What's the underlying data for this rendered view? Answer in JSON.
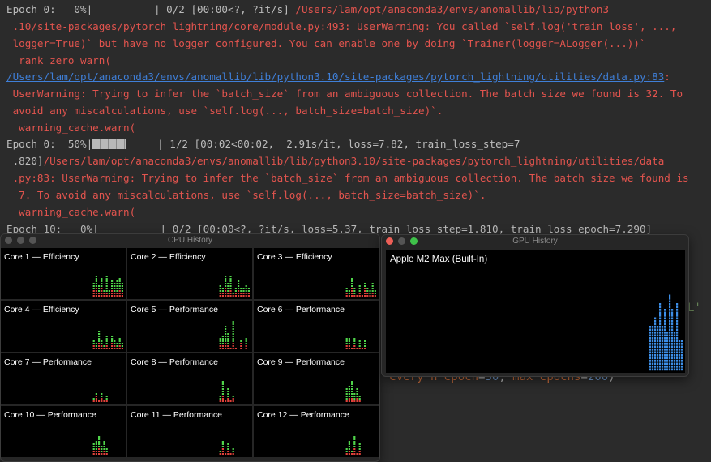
{
  "terminal": {
    "lines": [
      {
        "pre": "Epoch 0:   0%|          | 0/2 [00:00<?, ?it/s] ",
        "text": "/Users/lam/opt/anaconda3/envs/anomallib/lib/python3"
      },
      {
        "text": " .10/site-packages/pytorch_lightning/core/module.py:493: UserWarning: You called `self.log('train_loss', ...,"
      },
      {
        "text": " logger=True)` but have no logger configured. You can enable one by doing `Trainer(logger=ALogger(...))`"
      },
      {
        "text": "  rank_zero_warn("
      },
      {
        "link": "/Users/lam/opt/anaconda3/envs/anomallib/lib/python3.10/site-packages/pytorch_lightning/utilities/data.py:83",
        "text": ":"
      },
      {
        "text": " UserWarning: Trying to infer the `batch_size` from an ambiguous collection. The batch size we found is 32. To"
      },
      {
        "text": " avoid any miscalculations, use `self.log(..., batch_size=batch_size)`."
      },
      {
        "text": "  warning_cache.warn("
      },
      {
        "pre": "Epoch 0:  50%|",
        "bar": true,
        "pre2": "     | 1/2 [00:02<00:02,  2.91s/it, loss=7.82, train_loss_step=7"
      },
      {
        "pre": " .820]",
        "text": "/Users/lam/opt/anaconda3/envs/anomallib/lib/python3.10/site-packages/pytorch_lightning/utilities/data"
      },
      {
        "text": " .py:83: UserWarning: Trying to infer the `batch_size` from an ambiguous collection. The batch size we found is"
      },
      {
        "text": "  7. To avoid any miscalculations, use `self.log(..., batch_size=batch_size)`."
      },
      {
        "text": "  warning_cache.warn("
      },
      {
        "pre": "Epoch 10:   0%|          | 0/2 [00:00<?, ?it/s, loss=5.37, train_loss_step=1.810, train_loss_epoch=7.290]"
      }
    ],
    "progress_epoch0_percent": 50
  },
  "code_behind": {
    "a": "_every_n_epoch",
    "eq1": "=",
    "v1": "50",
    "c": ", ",
    "b": "max_epochs",
    "eq2": "=",
    "v2": "200",
    "close": ")",
    "ghost": "L'"
  },
  "cpu_window": {
    "title": "CPU History",
    "colors": {
      "user": "#4fd44a",
      "system": "#e0413a"
    },
    "cores": [
      {
        "label": "Core 1 — Efficiency",
        "total": [
          0.3,
          0.45,
          0.25,
          0.4,
          0.15,
          0.45,
          0.15,
          0.35,
          0.28,
          0.35,
          0.4,
          0.28
        ],
        "sys": [
          0.15,
          0.2,
          0.12,
          0.18,
          0.08,
          0.12,
          0.05,
          0.15,
          0.1,
          0.12,
          0.15,
          0.1
        ]
      },
      {
        "label": "Core 2 — Efficiency",
        "total": [
          0.25,
          0.2,
          0.45,
          0.3,
          0.45,
          0.1,
          0.2,
          0.35,
          0.2,
          0.2,
          0.25,
          0.2
        ],
        "sys": [
          0.12,
          0.1,
          0.2,
          0.12,
          0.15,
          0.05,
          0.08,
          0.15,
          0.08,
          0.1,
          0.12,
          0.08
        ]
      },
      {
        "label": "Core 3 — Efficiency",
        "total": [
          0.2,
          0.15,
          0.4,
          0.2,
          0.05,
          0.25,
          0.05,
          0.3,
          0.2,
          0.15,
          0.3,
          0.15
        ],
        "sys": [
          0.08,
          0.05,
          0.2,
          0.05,
          0.03,
          0.1,
          0.03,
          0.2,
          0.08,
          0.05,
          0.1,
          0.05
        ]
      },
      {
        "label": "Core 4 — Efficiency",
        "total": [
          0.2,
          0.15,
          0.4,
          0.2,
          0.1,
          0.3,
          0.05,
          0.3,
          0.2,
          0.15,
          0.25,
          0.15
        ],
        "sys": [
          0.08,
          0.05,
          0.15,
          0.08,
          0.03,
          0.1,
          0.03,
          0.15,
          0.08,
          0.05,
          0.1,
          0.05
        ]
      },
      {
        "label": "Core 5 — Performance",
        "total": [
          0.25,
          0.3,
          0.5,
          0.35,
          0.05,
          0.6,
          0.05,
          0.0,
          0.2,
          0.0,
          0.25,
          0.0
        ],
        "sys": [
          0.1,
          0.1,
          0.15,
          0.1,
          0.02,
          0.15,
          0.02,
          0.0,
          0.15,
          0.0,
          0.1,
          0.0
        ]
      },
      {
        "label": "Core 6 — Performance",
        "total": [
          0.25,
          0.25,
          0.05,
          0.25,
          0.05,
          0.22,
          0.05,
          0.2,
          0.0,
          0.0,
          0.0,
          0.0
        ],
        "sys": [
          0.1,
          0.08,
          0.02,
          0.1,
          0.02,
          0.05,
          0.02,
          0.05,
          0.0,
          0,
          0,
          0
        ]
      },
      {
        "label": "Core 7 — Performance",
        "total": [
          0.1,
          0.2,
          0.05,
          0.2,
          0.05,
          0.15,
          0.0,
          0,
          0,
          0,
          0,
          0
        ],
        "sys": [
          0.05,
          0.15,
          0.02,
          0.1,
          0.02,
          0.05,
          0,
          0,
          0,
          0,
          0,
          0
        ]
      },
      {
        "label": "Core 8 — Performance",
        "total": [
          0.15,
          0.45,
          0.05,
          0.3,
          0.05,
          0.15,
          0,
          0,
          0,
          0,
          0,
          0
        ],
        "sys": [
          0.05,
          0.15,
          0.02,
          0.1,
          0.02,
          0.08,
          0,
          0,
          0,
          0,
          0,
          0
        ]
      },
      {
        "label": "Core 9 — Performance",
        "total": [
          0.3,
          0.35,
          0.45,
          0.2,
          0.3,
          0.15,
          0,
          0,
          0,
          0,
          0,
          0
        ],
        "sys": [
          0.05,
          0.08,
          0.1,
          0.05,
          0.08,
          0.05,
          0,
          0,
          0,
          0,
          0,
          0
        ]
      },
      {
        "label": "Core 10 — Performance",
        "total": [
          0.25,
          0.3,
          0.4,
          0.2,
          0.3,
          0.15,
          0,
          0,
          0,
          0,
          0,
          0
        ],
        "sys": [
          0.1,
          0.12,
          0.15,
          0.05,
          0.1,
          0.05,
          0,
          0,
          0,
          0,
          0,
          0
        ]
      },
      {
        "label": "Core 11 — Performance",
        "total": [
          0.1,
          0.3,
          0.05,
          0.25,
          0.05,
          0.15,
          0,
          0,
          0,
          0,
          0,
          0
        ],
        "sys": [
          0.05,
          0.15,
          0.02,
          0.1,
          0.02,
          0.05,
          0,
          0,
          0,
          0,
          0,
          0
        ]
      },
      {
        "label": "Core 12 — Performance",
        "total": [
          0.15,
          0.3,
          0.1,
          0.4,
          0.05,
          0.25,
          0,
          0,
          0,
          0,
          0,
          0
        ],
        "sys": [
          0.05,
          0.12,
          0.05,
          0.15,
          0.02,
          0.1,
          0,
          0,
          0,
          0,
          0,
          0
        ]
      }
    ]
  },
  "gpu_window": {
    "title": "GPU History",
    "device": "Apple M2 Max (Built-In)",
    "color": "#3d8fe8",
    "usage": [
      0.6,
      0.6,
      0.7,
      0.6,
      0.9,
      0.6,
      0.8,
      0.5,
      1.0,
      0.8,
      0.5,
      0.9,
      0.4,
      0.4
    ]
  }
}
